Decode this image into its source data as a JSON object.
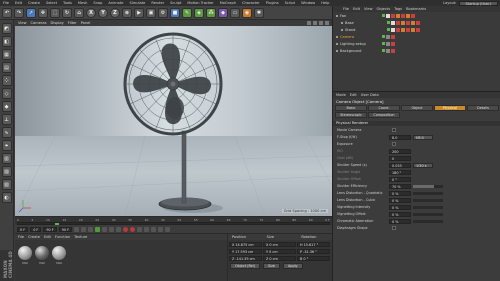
{
  "menubar": {
    "items": [
      "File",
      "Edit",
      "Create",
      "Select",
      "Tools",
      "Mesh",
      "Snap",
      "Animate",
      "Simulate",
      "Render",
      "Sculpt",
      "Motion Tracker",
      "MoGraph",
      "Character",
      "Plugins",
      "Script",
      "Window",
      "Help"
    ],
    "layout_label": "Layout:",
    "layout_value": "Startup (User)"
  },
  "toolbar": {
    "letters": [
      "X",
      "Y",
      "Z"
    ]
  },
  "viewport": {
    "menu": [
      "View",
      "Cameras",
      "Display",
      "Filter",
      "Panel"
    ],
    "grid_spacing": "Grid Spacing : 1000 cm"
  },
  "timeline": {
    "ticks": [
      "0",
      "5",
      "10",
      "15",
      "20",
      "25",
      "30",
      "35",
      "40",
      "45",
      "50",
      "55",
      "60",
      "65",
      "70",
      "75",
      "80",
      "85",
      "90"
    ],
    "end_label": "0 F",
    "current_frame_fraction": 0.12
  },
  "playbar": {
    "start": "0 F",
    "current": "0 F",
    "end": "90 F",
    "end2": "90 F"
  },
  "materials": {
    "menu": [
      "File",
      "Create",
      "Edit",
      "Function",
      "Texture"
    ],
    "items": [
      "Mat",
      "Mat",
      "Mat"
    ]
  },
  "coordinates": {
    "headers": [
      "Position",
      "Size",
      "Rotation"
    ],
    "rows": [
      [
        "X  14.875 cm",
        "X  0 cm",
        "H  15.617 °"
      ],
      [
        "Y  17.593 cm",
        "Y  0 cm",
        "P  -31.36 °"
      ],
      [
        "Z  -141.39 cm",
        "Z  0 cm",
        "B  0 °"
      ]
    ],
    "mode": "Object (Rel)",
    "size_mode": "Size",
    "apply": "Apply"
  },
  "brand": "MAXON CINEMA 4D",
  "objects": {
    "menu": [
      "File",
      "Edit",
      "View",
      "Objects",
      "Tags",
      "Bookmarks"
    ],
    "rows": [
      {
        "name": "Fan",
        "selected": false
      },
      {
        "name": "Base",
        "selected": false
      },
      {
        "name": "Stand",
        "selected": false
      },
      {
        "name": "Camera",
        "selected": true
      },
      {
        "name": "Lighting setup",
        "selected": false
      },
      {
        "name": "Background",
        "selected": false
      }
    ]
  },
  "attributes": {
    "menu": [
      "Mode",
      "Edit",
      "User Data"
    ],
    "title": "Camera Object [Camera]",
    "tabs": [
      "Basic",
      "Coord.",
      "Object",
      "Physical",
      "Details",
      "Stereoscopic",
      "Composition"
    ],
    "active_tab": "Physical",
    "section": "Physical Renderer",
    "props": [
      {
        "label": "Movie Camera",
        "value": "",
        "extra": "",
        "check": false,
        "dim": false
      },
      {
        "label": "F-Stop (f/#)",
        "value": "8.0",
        "extra": "f/8.0",
        "check": null,
        "dim": false
      },
      {
        "label": "Exposure",
        "value": "",
        "extra": "",
        "check": false,
        "dim": false
      },
      {
        "label": "ISO",
        "value": "200",
        "extra": "",
        "check": null,
        "dim": true
      },
      {
        "label": "Gain (dB)",
        "value": "0",
        "extra": "",
        "check": null,
        "dim": true
      },
      {
        "label": "Shutter Speed (s)",
        "value": "0.033",
        "extra": "1/30 s",
        "check": null,
        "dim": false
      },
      {
        "label": "Shutter Angle",
        "value": "180 °",
        "extra": "",
        "check": null,
        "dim": true
      },
      {
        "label": "Shutter Offset",
        "value": "0 °",
        "extra": "",
        "check": null,
        "dim": true
      },
      {
        "label": "Shutter Efficiency",
        "value": "70 %",
        "extra": "",
        "check": null,
        "dim": false
      },
      {
        "label": "Lens Distortion - Quadratic",
        "value": "0 %",
        "extra": "",
        "check": null,
        "dim": false
      },
      {
        "label": "Lens Distortion - Cubic",
        "value": "0 %",
        "extra": "",
        "check": null,
        "dim": false
      },
      {
        "label": "Vignetting Intensity",
        "value": "0 %",
        "extra": "",
        "check": null,
        "dim": false
      },
      {
        "label": "Vignetting Offset",
        "value": "0 %",
        "extra": "",
        "check": null,
        "dim": false
      },
      {
        "label": "Chromatic Aberration",
        "value": "0 %",
        "extra": "",
        "check": null,
        "dim": false
      },
      {
        "label": "Diaphragm Shape",
        "value": "",
        "extra": "",
        "check": false,
        "dim": false
      }
    ]
  }
}
